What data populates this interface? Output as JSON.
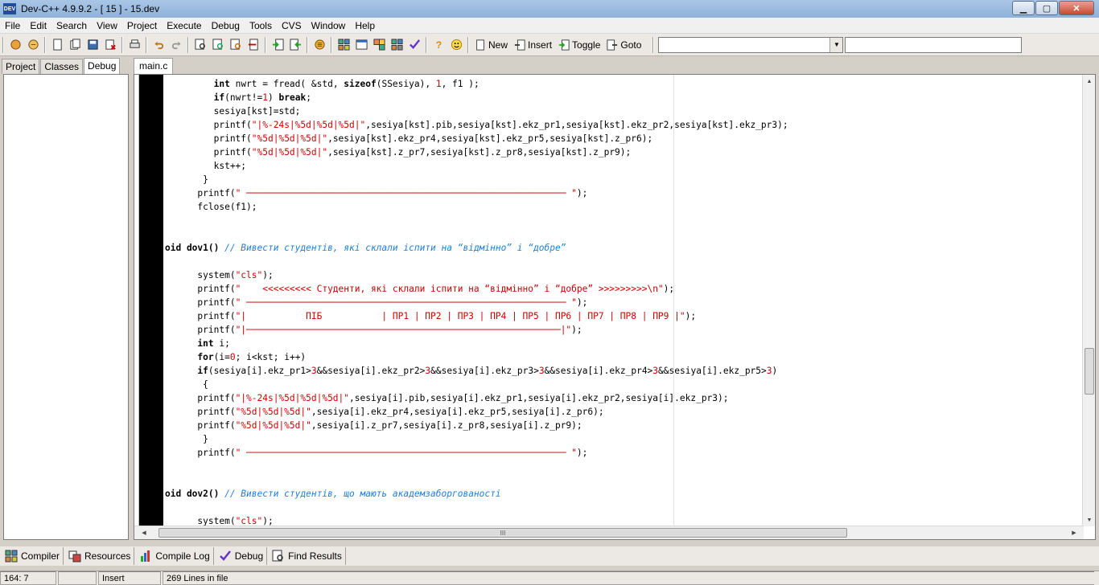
{
  "window": {
    "title": "Dev-C++ 4.9.9.2  - [ 15 ] - 15.dev",
    "icon_label": "DEV",
    "minimize_glyph": "▁",
    "maximize_glyph": "▢",
    "close_glyph": "✕"
  },
  "menu": [
    "File",
    "Edit",
    "Search",
    "View",
    "Project",
    "Execute",
    "Debug",
    "Tools",
    "CVS",
    "Window",
    "Help"
  ],
  "toolbar": {
    "new_label": "New",
    "insert_label": "Insert",
    "toggle_label": "Toggle",
    "goto_label": "Goto",
    "combo1_value": "",
    "combo2_value": "",
    "dropdown_glyph": "▼"
  },
  "left_tabs": [
    "Project",
    "Classes",
    "Debug"
  ],
  "editor": {
    "tab": "main.c",
    "scroll_glyphs": {
      "up": "▲",
      "down": "▼",
      "left": "◀",
      "right": "▶",
      "grip": "III"
    },
    "lines": [
      [
        {
          "t": "         "
        },
        {
          "t": "int",
          "c": "kw"
        },
        {
          "t": " nwrt = fread( &std, "
        },
        {
          "t": "sizeof",
          "c": "kw"
        },
        {
          "t": "(SSesiya), "
        },
        {
          "t": "1",
          "c": "num"
        },
        {
          "t": ", f1 );"
        }
      ],
      [
        {
          "t": "         "
        },
        {
          "t": "if",
          "c": "kw"
        },
        {
          "t": "(nwrt!="
        },
        {
          "t": "1",
          "c": "num"
        },
        {
          "t": ") "
        },
        {
          "t": "break",
          "c": "kw"
        },
        {
          "t": ";"
        }
      ],
      [
        {
          "t": "         sesiya[kst]=std;"
        }
      ],
      [
        {
          "t": "         printf("
        },
        {
          "t": "\"|%-24s|%5d|%5d|%5d|\"",
          "c": "str"
        },
        {
          "t": ",sesiya[kst].pib,sesiya[kst].ekz_pr1,sesiya[kst].ekz_pr2,sesiya[kst].ekz_pr3);"
        }
      ],
      [
        {
          "t": "         printf("
        },
        {
          "t": "\"%5d|%5d|%5d|\"",
          "c": "str"
        },
        {
          "t": ",sesiya[kst].ekz_pr4,sesiya[kst].ekz_pr5,sesiya[kst].z_pr6);"
        }
      ],
      [
        {
          "t": "         printf("
        },
        {
          "t": "\"%5d|%5d|%5d|\"",
          "c": "str"
        },
        {
          "t": ",sesiya[kst].z_pr7,sesiya[kst].z_pr8,sesiya[kst].z_pr9);"
        }
      ],
      [
        {
          "t": "         kst++;"
        }
      ],
      [
        {
          "t": "       }"
        }
      ],
      [
        {
          "t": "      printf("
        },
        {
          "t": "\" ─────────────────────────────────────────────────────────── \"",
          "c": "str"
        },
        {
          "t": ");"
        }
      ],
      [
        {
          "t": "      fclose(f1);"
        }
      ],
      [
        {
          "t": ""
        }
      ],
      [
        {
          "t": ""
        }
      ],
      [
        {
          "t": "oid dov1() ",
          "c": "kw"
        },
        {
          "t": "// Вивести студентів, які склали іспити на “відмінно” і “добре”",
          "c": "cmt"
        }
      ],
      [
        {
          "t": ""
        }
      ],
      [
        {
          "t": "      system("
        },
        {
          "t": "\"cls\"",
          "c": "str"
        },
        {
          "t": ");"
        }
      ],
      [
        {
          "t": "      printf("
        },
        {
          "t": "\"    <<<<<<<<< Студенти, які склали іспити на “відмінно” і “добре” >>>>>>>>>\\n\"",
          "c": "str"
        },
        {
          "t": ");"
        }
      ],
      [
        {
          "t": "      printf("
        },
        {
          "t": "\" ─────────────────────────────────────────────────────────── \"",
          "c": "str"
        },
        {
          "t": ");"
        }
      ],
      [
        {
          "t": "      printf("
        },
        {
          "t": "\"|           ПІБ           | ПР1 | ПР2 | ПР3 | ПР4 | ПР5 | ПР6 | ПР7 | ПР8 | ПР9 |\"",
          "c": "str"
        },
        {
          "t": ");"
        }
      ],
      [
        {
          "t": "      printf("
        },
        {
          "t": "\"|──────────────────────────────────────────────────────────|\"",
          "c": "str"
        },
        {
          "t": ");"
        }
      ],
      [
        {
          "t": "      "
        },
        {
          "t": "int",
          "c": "kw"
        },
        {
          "t": " i;"
        }
      ],
      [
        {
          "t": "      "
        },
        {
          "t": "for",
          "c": "kw"
        },
        {
          "t": "(i="
        },
        {
          "t": "0",
          "c": "num"
        },
        {
          "t": "; i<kst; i++)"
        }
      ],
      [
        {
          "t": "      "
        },
        {
          "t": "if",
          "c": "kw"
        },
        {
          "t": "(sesiya[i].ekz_pr1>"
        },
        {
          "t": "3",
          "c": "num"
        },
        {
          "t": "&&sesiya[i].ekz_pr2>"
        },
        {
          "t": "3",
          "c": "num"
        },
        {
          "t": "&&sesiya[i].ekz_pr3>"
        },
        {
          "t": "3",
          "c": "num"
        },
        {
          "t": "&&sesiya[i].ekz_pr4>"
        },
        {
          "t": "3",
          "c": "num"
        },
        {
          "t": "&&sesiya[i].ekz_pr5>"
        },
        {
          "t": "3",
          "c": "num"
        },
        {
          "t": ")"
        }
      ],
      [
        {
          "t": "       {"
        }
      ],
      [
        {
          "t": "      printf("
        },
        {
          "t": "\"|%-24s|%5d|%5d|%5d|\"",
          "c": "str"
        },
        {
          "t": ",sesiya[i].pib,sesiya[i].ekz_pr1,sesiya[i].ekz_pr2,sesiya[i].ekz_pr3);"
        }
      ],
      [
        {
          "t": "      printf("
        },
        {
          "t": "\"%5d|%5d|%5d|\"",
          "c": "str"
        },
        {
          "t": ",sesiya[i].ekz_pr4,sesiya[i].ekz_pr5,sesiya[i].z_pr6);"
        }
      ],
      [
        {
          "t": "      printf("
        },
        {
          "t": "\"%5d|%5d|%5d|\"",
          "c": "str"
        },
        {
          "t": ",sesiya[i].z_pr7,sesiya[i].z_pr8,sesiya[i].z_pr9);"
        }
      ],
      [
        {
          "t": "       }"
        }
      ],
      [
        {
          "t": "      printf("
        },
        {
          "t": "\" ─────────────────────────────────────────────────────────── \"",
          "c": "str"
        },
        {
          "t": ");"
        }
      ],
      [
        {
          "t": ""
        }
      ],
      [
        {
          "t": ""
        }
      ],
      [
        {
          "t": "oid dov2() ",
          "c": "kw"
        },
        {
          "t": "// Вивести студентів, що мають академзаборгованості",
          "c": "cmt"
        }
      ],
      [
        {
          "t": ""
        }
      ],
      [
        {
          "t": "      system("
        },
        {
          "t": "\"cls\"",
          "c": "str"
        },
        {
          "t": ");"
        }
      ]
    ]
  },
  "bottom_tabs": [
    "Compiler",
    "Resources",
    "Compile Log",
    "Debug",
    "Find Results"
  ],
  "status": {
    "position": "164: 7",
    "blank": "",
    "mode": "Insert",
    "lines_info": "269 Lines in file"
  }
}
